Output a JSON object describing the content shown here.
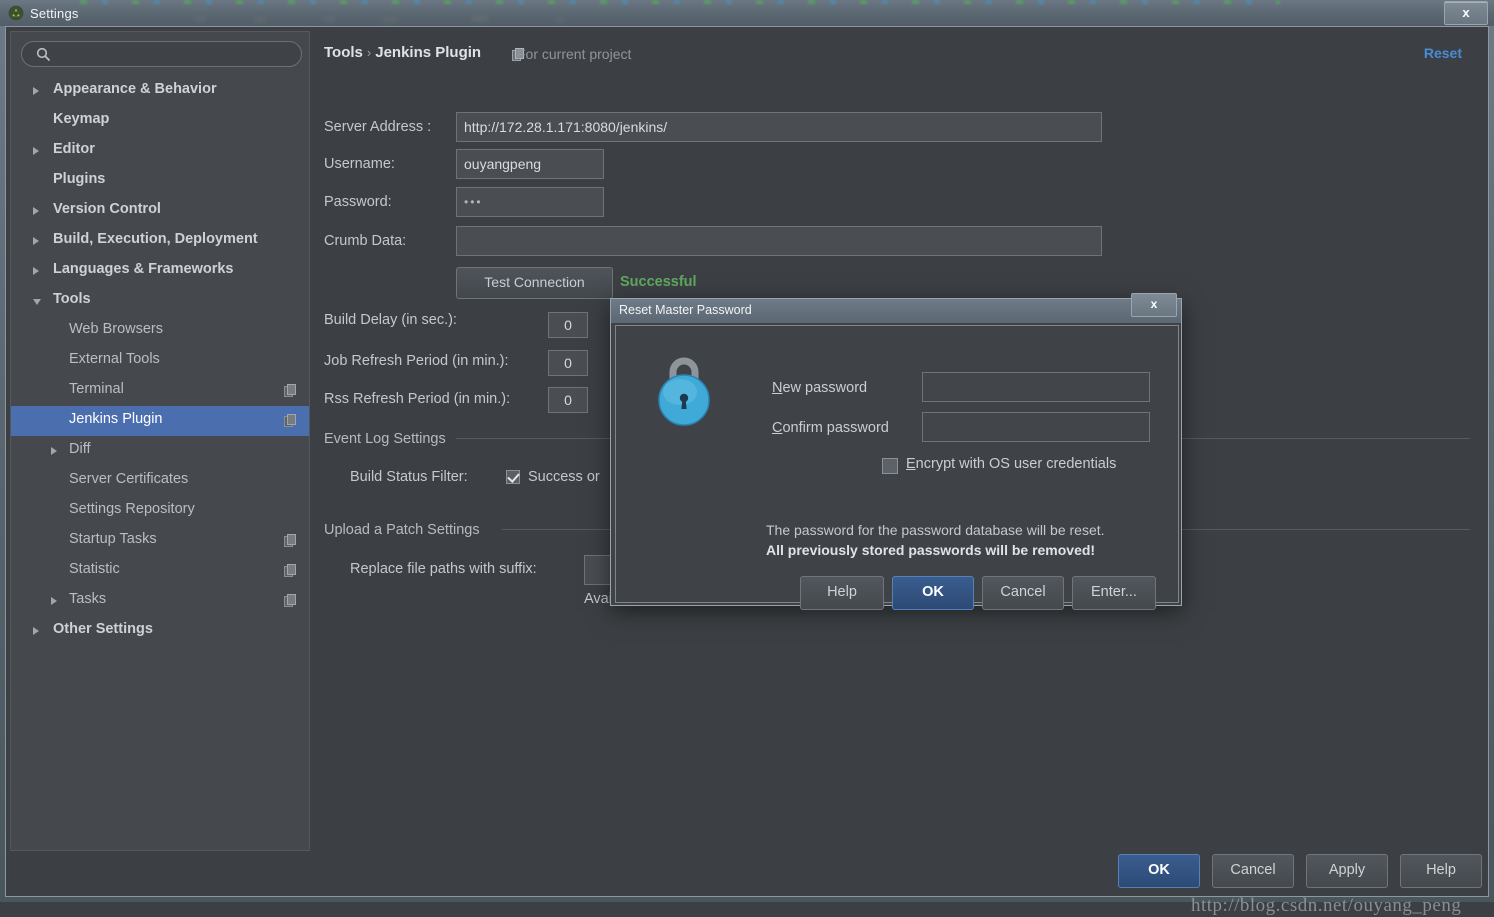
{
  "window": {
    "title": "Settings",
    "app_icon": "android-studio-icon",
    "close_label": "x"
  },
  "sidebar": {
    "search": {
      "value": "",
      "placeholder": "",
      "icon": "search-icon"
    },
    "items": [
      {
        "label": "Appearance & Behavior",
        "level": "top",
        "arrow": "closed",
        "copy": false,
        "selected": false
      },
      {
        "label": "Keymap",
        "level": "top",
        "arrow": "none",
        "copy": false,
        "selected": false
      },
      {
        "label": "Editor",
        "level": "top",
        "arrow": "closed",
        "copy": false,
        "selected": false
      },
      {
        "label": "Plugins",
        "level": "top",
        "arrow": "none",
        "copy": false,
        "selected": false
      },
      {
        "label": "Version Control",
        "level": "top",
        "arrow": "closed",
        "copy": false,
        "selected": false
      },
      {
        "label": "Build, Execution, Deployment",
        "level": "top",
        "arrow": "closed",
        "copy": false,
        "selected": false
      },
      {
        "label": "Languages & Frameworks",
        "level": "top",
        "arrow": "closed",
        "copy": false,
        "selected": false
      },
      {
        "label": "Tools",
        "level": "top",
        "arrow": "open",
        "copy": false,
        "selected": false
      },
      {
        "label": "Web Browsers",
        "level": "child",
        "arrow": "none",
        "copy": false,
        "selected": false
      },
      {
        "label": "External Tools",
        "level": "child",
        "arrow": "none",
        "copy": false,
        "selected": false
      },
      {
        "label": "Terminal",
        "level": "child",
        "arrow": "none",
        "copy": true,
        "selected": false
      },
      {
        "label": "Jenkins Plugin",
        "level": "child",
        "arrow": "none",
        "copy": true,
        "selected": true
      },
      {
        "label": "Diff",
        "level": "child",
        "arrow": "closed",
        "copy": false,
        "selected": false
      },
      {
        "label": "Server Certificates",
        "level": "child",
        "arrow": "none",
        "copy": false,
        "selected": false
      },
      {
        "label": "Settings Repository",
        "level": "child",
        "arrow": "none",
        "copy": false,
        "selected": false
      },
      {
        "label": "Startup Tasks",
        "level": "child",
        "arrow": "none",
        "copy": true,
        "selected": false
      },
      {
        "label": "Statistic",
        "level": "child",
        "arrow": "none",
        "copy": true,
        "selected": false
      },
      {
        "label": "Tasks",
        "level": "child",
        "arrow": "closed",
        "copy": true,
        "selected": false
      },
      {
        "label": "Other Settings",
        "level": "top",
        "arrow": "closed",
        "copy": false,
        "selected": false
      }
    ]
  },
  "main": {
    "breadcrumb": {
      "root": "Tools",
      "separator": "›",
      "leaf": "Jenkins Plugin"
    },
    "scope_label": "For current project",
    "scope_icon": "copy-scope-icon",
    "reset_label": "Reset",
    "fields": {
      "server_address_label": "Server Address :",
      "server_address_value": "http://172.28.1.171:8080/jenkins/",
      "username_label": "Username:",
      "username_value": "ouyangpeng",
      "password_label": "Password:",
      "password_value": "•••",
      "crumb_label": "Crumb Data:",
      "crumb_value": ""
    },
    "test_connection_label": "Test Connection",
    "test_connection_status": "Successful",
    "build_delay_label": "Build Delay (in sec.):",
    "build_delay_value": "0",
    "job_refresh_label": "Job Refresh Period (in min.):",
    "job_refresh_value": "0",
    "rss_refresh_label": "Rss Refresh Period (in min.):",
    "rss_refresh_value": "0",
    "event_log_section": "Event Log Settings",
    "build_status_filter_label": "Build Status Filter:",
    "build_status_filter_value": "Success or",
    "upload_patch_section": "Upload a Patch Settings",
    "replace_suffix_label": "Replace file paths with suffix:",
    "replace_suffix_value": "",
    "available_label": "Avai"
  },
  "buttons": {
    "ok": "OK",
    "cancel": "Cancel",
    "apply": "Apply",
    "help": "Help"
  },
  "modal": {
    "title": "Reset Master Password",
    "close_label": "x",
    "icon": "padlock-icon",
    "new_password_label_prefix": "N",
    "new_password_label_rest": "ew password",
    "new_password_value": "",
    "confirm_password_label_prefix": "C",
    "confirm_password_label_rest": "onfirm password",
    "confirm_password_value": "",
    "encrypt_checkbox_prefix": "E",
    "encrypt_checkbox_rest": "ncrypt with OS user credentials",
    "encrypt_checked": false,
    "message_line1": "The password for the password database will be reset.",
    "message_line2": "All previously stored passwords will be removed!",
    "buttons": {
      "help": "Help",
      "ok": "OK",
      "cancel": "Cancel",
      "enter": "Enter..."
    }
  },
  "watermark": "http://blog.csdn.net/ouyang_peng",
  "colors": {
    "accent_blue": "#4b6eaf",
    "link_blue": "#4a8bd6",
    "success_green": "#5fa85f",
    "panel_bg": "#3c4044",
    "sidebar_bg": "#45494e"
  }
}
